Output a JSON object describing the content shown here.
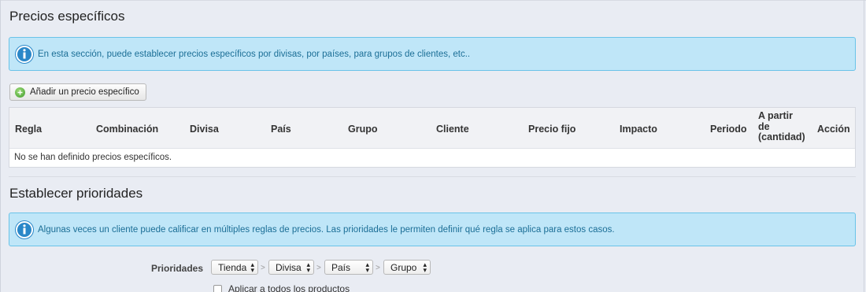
{
  "specific_prices": {
    "title": "Precios específicos",
    "info_text": "En esta sección, puede establecer precios específicos por divisas, por países, para grupos de clientes, etc..",
    "add_button_label": "Añadir un precio específico",
    "table": {
      "headers": [
        "Regla",
        "Combinación",
        "Divisa",
        "País",
        "Grupo",
        "Cliente",
        "Precio fijo",
        "Impacto",
        "Periodo",
        "A partir de (cantidad)",
        "Acción"
      ],
      "header_lines": {
        "a_partir": [
          "A partir",
          "de",
          "(cantidad)"
        ]
      },
      "empty_message": "No se han definido precios específicos."
    }
  },
  "priorities": {
    "title": "Establecer prioridades",
    "info_text": "Algunas veces un cliente puede calificar en múltiples reglas de precios. Las prioridades le permiten definir qué regla se aplica para estos casos.",
    "label": "Prioridades",
    "selects": [
      "Tienda",
      "Divisa",
      "País",
      "Grupo"
    ],
    "separator": ">",
    "apply_all_label": "Aplicar a todos los productos",
    "apply_all_checked": false
  },
  "colors": {
    "info_bg": "#bfe6f8",
    "info_border": "#6ac3e8",
    "info_text": "#1b6e96",
    "info_icon": "#2a87c8"
  },
  "icons": {
    "info": "info-icon",
    "add": "plus-circle-icon",
    "select_arrows": "up-down-arrows-icon"
  }
}
